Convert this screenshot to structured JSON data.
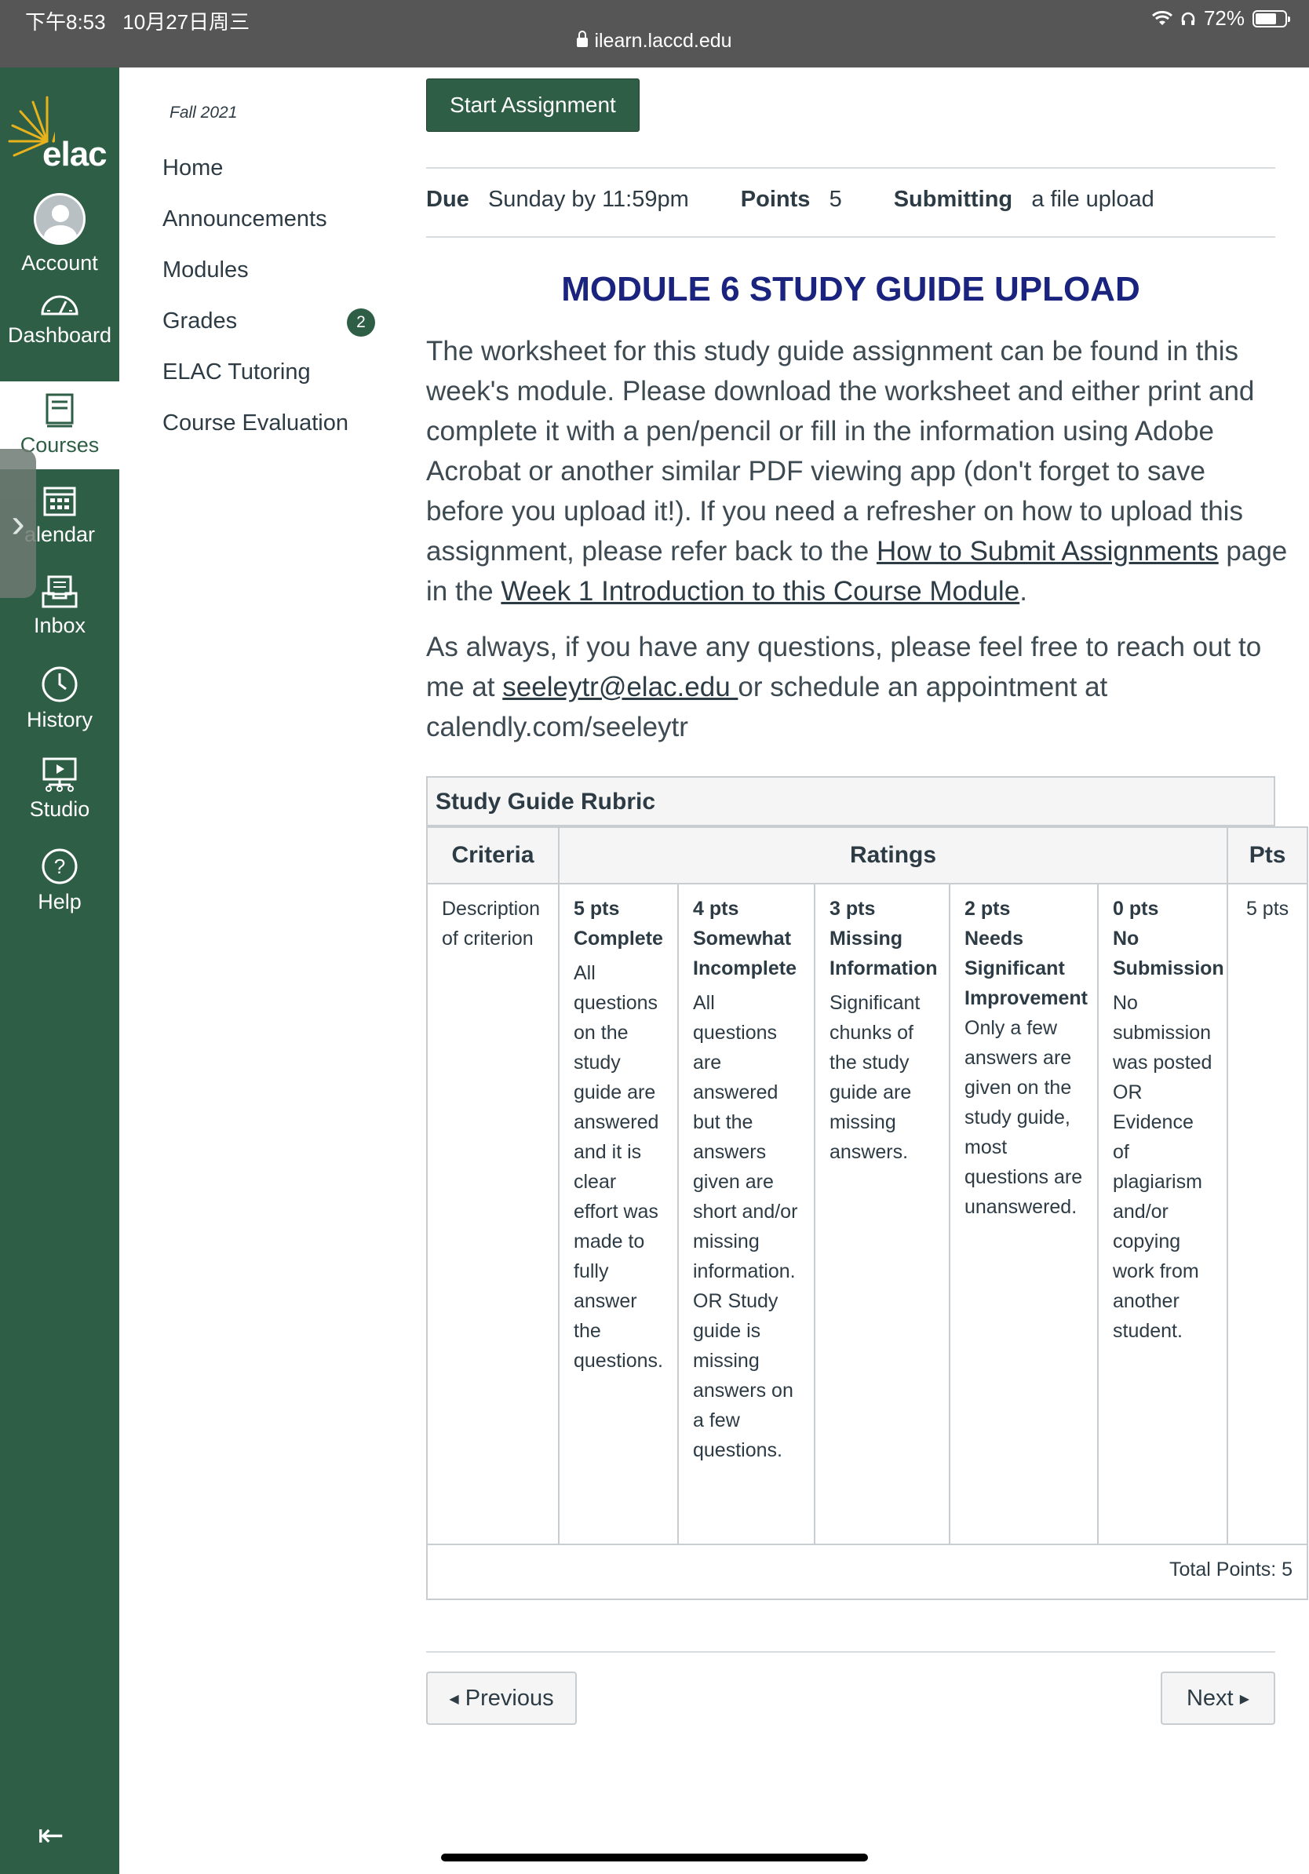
{
  "status": {
    "time": "下午8:53",
    "date": "10月27日周三",
    "url": "ilearn.laccd.edu",
    "battery": "72%",
    "battery_level": 0.72
  },
  "globalnav": {
    "logo": "elac",
    "items": [
      {
        "label": "Account",
        "icon": "user-avatar-icon"
      },
      {
        "label": "Dashboard",
        "icon": "dashboard-icon"
      },
      {
        "label": "Courses",
        "icon": "courses-icon"
      },
      {
        "label": "alendar",
        "icon": "calendar-icon"
      },
      {
        "label": "Inbox",
        "icon": "inbox-icon"
      },
      {
        "label": "History",
        "icon": "history-icon"
      },
      {
        "label": "Studio",
        "icon": "studio-icon"
      },
      {
        "label": "Help",
        "icon": "help-icon"
      }
    ]
  },
  "coursenav": {
    "term": "Fall 2021",
    "items": [
      "Home",
      "Announcements",
      "Modules",
      "Grades",
      "ELAC Tutoring",
      "Course Evaluation"
    ],
    "grades_badge": "2"
  },
  "assignment": {
    "start_button": "Start Assignment",
    "due_label": "Due",
    "due_value": "Sunday by 11:59pm",
    "points_label": "Points",
    "points_value": "5",
    "submitting_label": "Submitting",
    "submitting_value": "a file upload",
    "title": "MODULE 6 STUDY GUIDE UPLOAD",
    "para1_a": "The worksheet for this study guide assignment can be found in this week's module.  Please download the worksheet and either print and complete it with a pen/pencil or fill in the information using Adobe Acrobat or another similar PDF viewing app (don't forget to save before you upload it!).  If you need a refresher on how to upload this assignment, please refer back to the ",
    "link1": "How to Submit Assignments",
    "para1_b": " page in the ",
    "link2": "Week 1 Introduction to this Course Module",
    "para1_c": ".",
    "para2_a": "As always, if you have any questions, please feel free to reach out to me at ",
    "email": "seeleytr@elac.edu ",
    "para2_b": "or schedule an appointment at calendly.com/seeleytr"
  },
  "rubric": {
    "title": "Study Guide Rubric",
    "col_criteria": "Criteria",
    "col_ratings": "Ratings",
    "col_pts": "Pts",
    "criterion": "Description of criterion",
    "ratings": [
      {
        "pts": "5 pts",
        "name": "Complete",
        "desc": "All questions on the study guide are answered and it is clear effort was made to fully answer the questions."
      },
      {
        "pts": "4 pts",
        "name": "Somewhat Incomplete",
        "desc": "All questions are answered but the answers given are short and/or missing information. OR Study guide is missing answers on a few questions."
      },
      {
        "pts": "3 pts",
        "name": "Missing Information",
        "desc": "Significant chunks of the study guide are missing answers."
      },
      {
        "pts": "2 pts",
        "name": "Needs Significant Improvement",
        "desc": "Only a few answers are given on the study guide, most questions are unanswered."
      },
      {
        "pts": "0 pts",
        "name": "No Submission",
        "desc": "No submission was posted OR Evidence of plagiarism and/or copying work from another student."
      }
    ],
    "pts_value": "5 pts",
    "total": "Total Points: 5"
  },
  "pager": {
    "previous": "Previous",
    "next": "Next"
  }
}
